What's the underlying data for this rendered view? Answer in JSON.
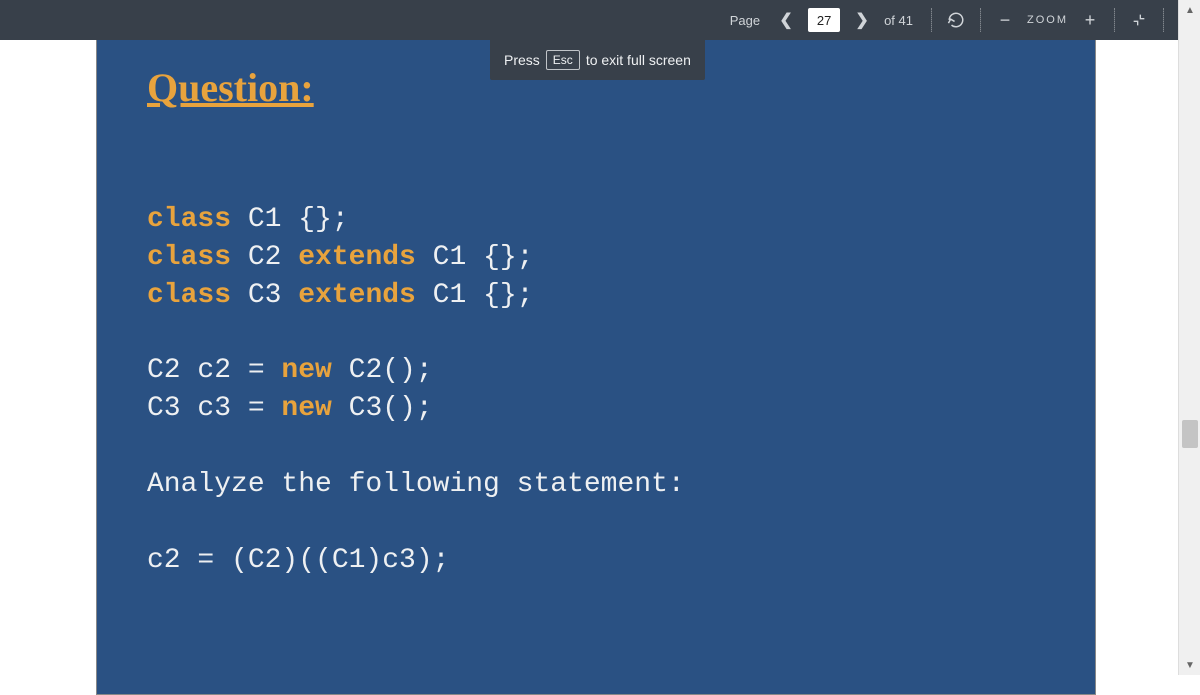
{
  "toolbar": {
    "page_label": "Page",
    "current_page": "27",
    "of_label": "of 41",
    "zoom_label": "ZOOM"
  },
  "esc_notice": {
    "press": "Press",
    "key": "Esc",
    "rest": "to exit full screen"
  },
  "slide": {
    "title": "Question:",
    "code": {
      "l1_kw": "class",
      "l1_rest": " C1 {};",
      "l2_kw1": "class",
      "l2_mid": " C2 ",
      "l2_kw2": "extends",
      "l2_rest": " C1 {};",
      "l3_kw1": "class",
      "l3_mid": " C3 ",
      "l3_kw2": "extends",
      "l3_rest": " C1 {};",
      "l4_pre": "C2 c2 = ",
      "l4_kw": "new",
      "l4_rest": " C2();",
      "l5_pre": "C3 c3 = ",
      "l5_kw": "new",
      "l5_rest": " C3();",
      "l6": "Analyze the following statement:",
      "l7": "c2 = (C2)((C1)c3);"
    }
  }
}
